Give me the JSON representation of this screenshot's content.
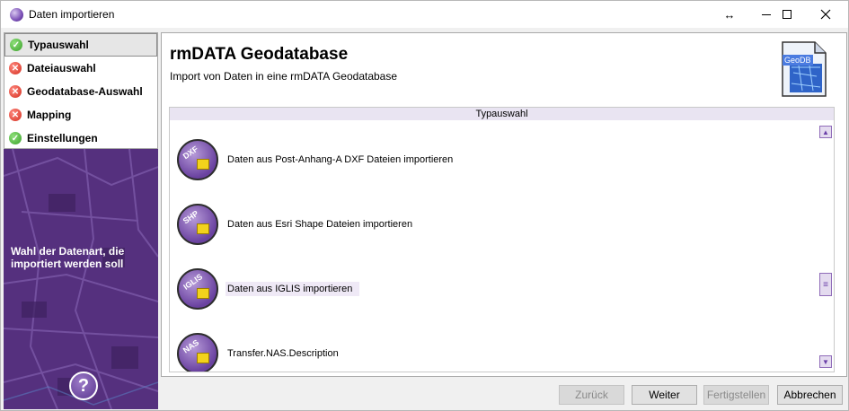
{
  "window": {
    "title": "Daten importieren",
    "resize_glyph": "↔"
  },
  "steps": [
    {
      "label": "Typauswahl",
      "status": "ok"
    },
    {
      "label": "Dateiauswahl",
      "status": "error"
    },
    {
      "label": "Geodatabase-Auswahl",
      "status": "error"
    },
    {
      "label": "Mapping",
      "status": "error"
    },
    {
      "label": "Einstellungen",
      "status": "ok"
    }
  ],
  "sidebar": {
    "hint": "Wahl der Datenart, die importiert werden soll",
    "help_glyph": "?"
  },
  "header": {
    "title": "rmDATA Geodatabase",
    "subtitle": "Import von Daten in eine rmDATA Geodatabase",
    "logo_text": "GeoDB"
  },
  "list": {
    "header": "Typauswahl",
    "items": [
      {
        "tag": "DXF",
        "label": "Daten aus Post-Anhang-A DXF Dateien importieren"
      },
      {
        "tag": "SHP",
        "label": "Daten aus Esri Shape Dateien importieren"
      },
      {
        "tag": "IGLIS",
        "label": "Daten aus IGLIS importieren"
      },
      {
        "tag": "NAS",
        "label": "Transfer.NAS.Description"
      }
    ]
  },
  "buttons": {
    "back": "Zurück",
    "next": "Weiter",
    "finish": "Fertigstellen",
    "cancel": "Abbrechen"
  },
  "colors": {
    "accent": "#6a42a0",
    "ok": "#3aa12a",
    "error": "#d42e1f"
  }
}
